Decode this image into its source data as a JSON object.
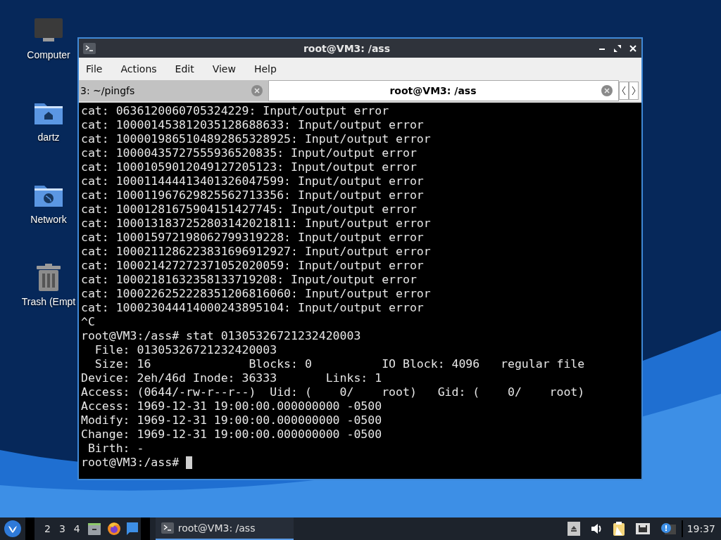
{
  "desktop_icons": [
    {
      "kind": "computer",
      "label": "Computer"
    },
    {
      "kind": "home",
      "label": "dartz"
    },
    {
      "kind": "network",
      "label": "Network"
    },
    {
      "kind": "trash",
      "label": "Trash (Empt"
    }
  ],
  "window": {
    "title": "root@VM3: /ass",
    "menu": [
      "File",
      "Actions",
      "Edit",
      "View",
      "Help"
    ],
    "tabs": [
      {
        "label": "3: ~/pingfs",
        "selected": false
      },
      {
        "label": "root@VM3: /ass",
        "selected": true
      }
    ],
    "terminal_lines": [
      "cat: 0636120060705324229: Input/output error",
      "cat: 100001453812035128688633: Input/output error",
      "cat: 1000019865104892865328925: Input/output error",
      "cat: 10000435727555936520835: Input/output error",
      "cat: 10001059012049127205123: Input/output error",
      "cat: 100011444413401326047599: Input/output error",
      "cat: 100011967629825562713356: Input/output error",
      "cat: 10001281675904151427745: Input/output error",
      "cat: 1000131837252803142021811: Input/output error",
      "cat: 100015972198062799319228: Input/output error",
      "cat: 1000211286223831696912927: Input/output error",
      "cat: 100021427272371052020059: Input/output error",
      "cat: 10002181632358133719208: Input/output error",
      "cat: 1000226252228351206816060: Input/output error",
      "cat: 100023044414000243895104: Input/output error",
      "^C",
      "root@VM3:/ass# stat 01305326721232420003",
      "  File: 01305326721232420003",
      "  Size: 16              Blocks: 0          IO Block: 4096   regular file",
      "Device: 2eh/46d Inode: 36333       Links: 1",
      "Access: (0644/-rw-r--r--)  Uid: (    0/    root)   Gid: (    0/    root)",
      "Access: 1969-12-31 19:00:00.000000000 -0500",
      "Modify: 1969-12-31 19:00:00.000000000 -0500",
      "Change: 1969-12-31 19:00:00.000000000 -0500",
      " Birth: -",
      "root@VM3:/ass# "
    ],
    "cursor_visible": true
  },
  "taskbar": {
    "workspaces": [
      "2",
      "3",
      "4"
    ],
    "task": {
      "label": "root@VM3: /ass",
      "selected": true
    },
    "clock": "19:37"
  }
}
